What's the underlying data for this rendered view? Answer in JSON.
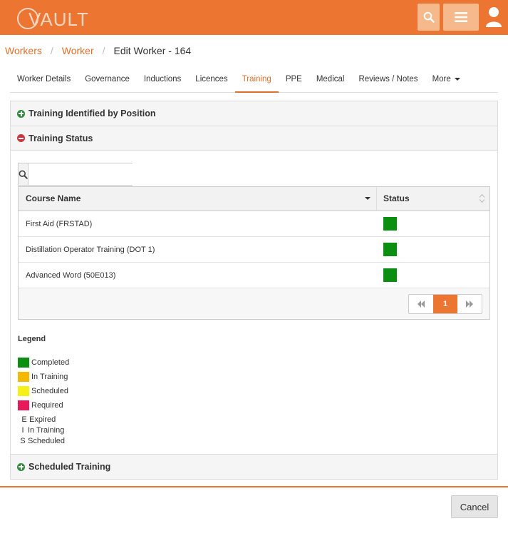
{
  "app": {
    "logo_text": "VAULT"
  },
  "topbar": {
    "search_icon": "search-icon",
    "menu_icon": "hamburger-menu-icon",
    "user_icon": "user-icon"
  },
  "breadcrumb": [
    {
      "label": "Workers"
    },
    {
      "label": "Worker"
    },
    {
      "label": "Edit Worker - 164"
    }
  ],
  "tabs": [
    {
      "label": "Worker Details"
    },
    {
      "label": "Governance"
    },
    {
      "label": "Inductions"
    },
    {
      "label": "Licences"
    },
    {
      "label": "Training",
      "active": true
    },
    {
      "label": "PPE"
    },
    {
      "label": "Medical"
    },
    {
      "label": "Reviews / Notes"
    },
    {
      "label": "More"
    }
  ],
  "panels": {
    "identified": {
      "title": "Training Identified by Position",
      "expanded": false
    },
    "status": {
      "title": "Training Status",
      "expanded": true
    },
    "scheduled": {
      "title": "Scheduled Training",
      "expanded": false
    }
  },
  "search": {
    "value": "",
    "placeholder": ""
  },
  "grid": {
    "columns": [
      "Course Name",
      "Status"
    ],
    "rows": [
      {
        "course": "First Aid (FRSTAD)",
        "status": "Completed"
      },
      {
        "course": "Distillation Operator Training (DOT 1)",
        "status": "Completed"
      },
      {
        "course": "Advanced Word (50E013)",
        "status": "Completed"
      }
    ],
    "page": "1"
  },
  "legend": {
    "title": "Legend",
    "colors": [
      {
        "label": "Completed",
        "color": "#0b8f11"
      },
      {
        "label": "In Training",
        "color": "#f5b800"
      },
      {
        "label": "Scheduled",
        "color": "#f4f018"
      },
      {
        "label": "Required",
        "color": "#e8195b"
      }
    ],
    "codes": [
      {
        "code": "E",
        "label": "Expired"
      },
      {
        "code": "I",
        "label": "In Training"
      },
      {
        "code": "S",
        "label": "Scheduled"
      }
    ]
  },
  "footer": {
    "cancel_label": "Cancel"
  }
}
